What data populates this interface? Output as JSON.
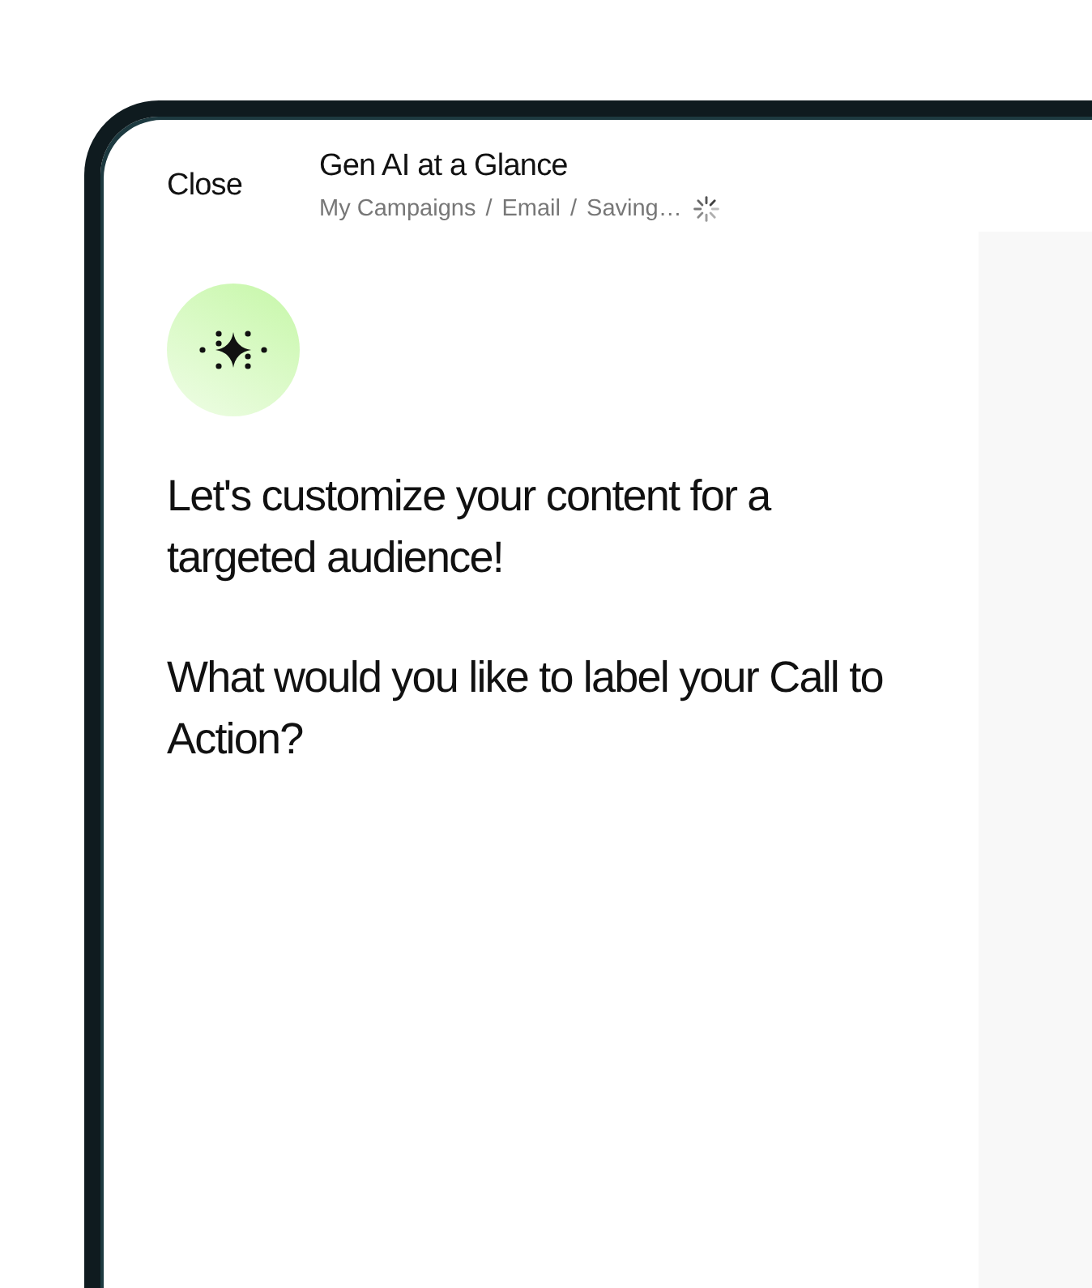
{
  "header": {
    "close": "Close",
    "title": "Gen AI at a Glance",
    "breadcrumb": [
      {
        "kind": "link",
        "text": "My Campaigns"
      },
      {
        "kind": "separator",
        "text": "/"
      },
      {
        "kind": "link",
        "text": "Email"
      },
      {
        "kind": "separator",
        "text": "/"
      },
      {
        "kind": "status",
        "text": "Saving…",
        "busy": true
      }
    ]
  },
  "messages": [
    "Let's customize your content for a targeted audience!",
    "What would you like to label your Call to Action?"
  ]
}
